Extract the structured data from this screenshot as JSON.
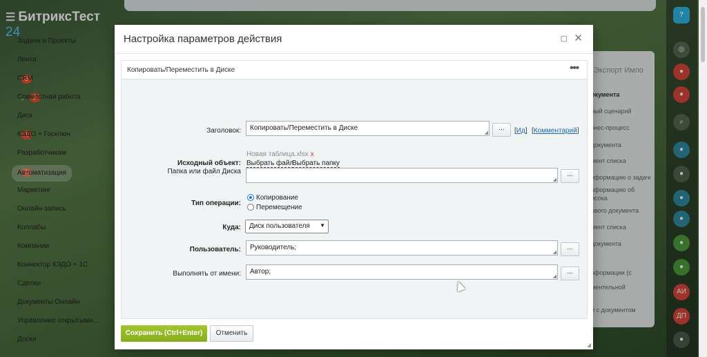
{
  "app": {
    "logo_text": "БитриксТест",
    "logo_number": "24",
    "menu": [
      {
        "label": "Задачи и Проекты"
      },
      {
        "label": "Лента"
      },
      {
        "label": "CRM",
        "count": "3"
      },
      {
        "label": "Совместная работа",
        "count": "9",
        "chevron": true
      },
      {
        "label": "Диск"
      },
      {
        "label": "КЭДО + Госключ",
        "count": "1"
      },
      {
        "label": "Разработчикам"
      },
      {
        "label": "Автоматизация",
        "count": "1",
        "active": true
      },
      {
        "label": "Маркетинг"
      },
      {
        "label": "Онлайн-запись"
      },
      {
        "label": "Коллабы"
      },
      {
        "label": "Компании"
      },
      {
        "label": "Коннектор КЭДО + 1С"
      },
      {
        "label": "Сделки"
      },
      {
        "label": "Документы Онлайн"
      },
      {
        "label": "Управление открытыми..."
      },
      {
        "label": "Доски"
      }
    ],
    "right_panel": {
      "tabs": "Экспорт   Импо",
      "header": "окумента",
      "items": [
        "ный сценарий",
        "знес-процесс",
        "документа",
        "мент списка",
        "нформацию о задаче",
        "нформацию об",
        "исока",
        "ового документа",
        "мент списка",
        "документа",
        "нформации (с",
        "ментельной",
        "и с документом"
      ]
    },
    "right_bar": {
      "help": "?",
      "avatars": [
        "АИ",
        "ДП"
      ]
    }
  },
  "dialog": {
    "title": "Настройка параметров действия",
    "block_title": "Копировать/Переместить в Диске",
    "fields": {
      "title_label": "Заголовок:",
      "title_value": "Копировать/Переместить в Диске",
      "id_link": "Ид",
      "comment_link": "Комментарий",
      "source_label": "Исходный объект:",
      "source_sublabel": "Папка или файл Диска",
      "source_file": "Новая таблица.xlsx",
      "source_file_remove": "x",
      "choose_file": "Выбрать файл",
      "choose_folder": "Выбрать папку",
      "source_value": "",
      "operation_label": "Тип операции:",
      "operation_options": [
        "Копирование",
        "Перемещение"
      ],
      "operation_selected": 0,
      "where_label": "Куда:",
      "where_value": "Диск пользователя",
      "user_label": "Пользователь:",
      "user_value": "Руководитель;",
      "run_as_label": "Выполнять от имени:",
      "run_as_value": "Автор;",
      "dots": "..."
    },
    "save_button": "Сохранить (Ctrl+Enter)",
    "cancel_button": "Отменить"
  }
}
